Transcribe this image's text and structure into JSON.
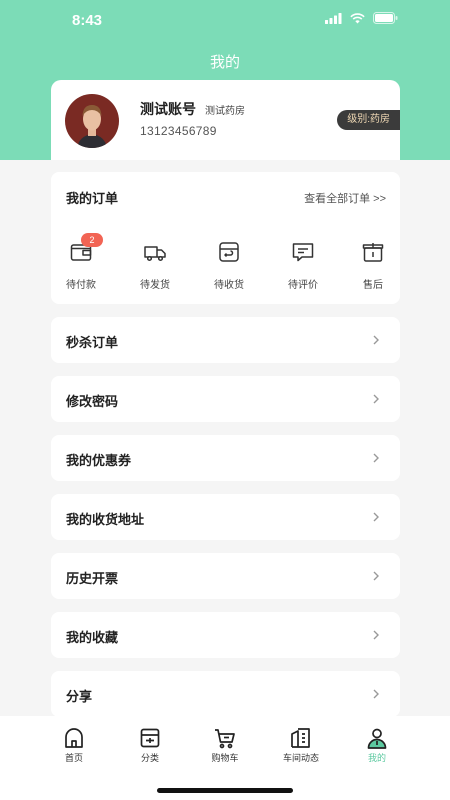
{
  "status_bar": {
    "time": "8:43"
  },
  "header": {
    "title": "我的"
  },
  "profile": {
    "name": "测试账号",
    "tag": "测试药房",
    "phone": "13123456789",
    "level": "级别:药房"
  },
  "orders": {
    "title": "我的订单",
    "view_all": "查看全部订单 >>",
    "items": [
      {
        "label": "待付款",
        "icon": "wallet-icon",
        "badge": "2"
      },
      {
        "label": "待发货",
        "icon": "truck-icon"
      },
      {
        "label": "待收货",
        "icon": "receive-box-icon"
      },
      {
        "label": "待评价",
        "icon": "comment-icon"
      },
      {
        "label": "售后",
        "icon": "after-sale-box-icon"
      }
    ]
  },
  "menu": [
    {
      "label": "秒杀订单"
    },
    {
      "label": "修改密码"
    },
    {
      "label": "我的优惠券"
    },
    {
      "label": "我的收货地址"
    },
    {
      "label": "历史开票"
    },
    {
      "label": "我的收藏"
    },
    {
      "label": "分享"
    }
  ],
  "tabbar": {
    "items": [
      {
        "label": "首页",
        "icon": "home-icon"
      },
      {
        "label": "分类",
        "icon": "category-icon"
      },
      {
        "label": "购物车",
        "icon": "cart-icon"
      },
      {
        "label": "车间动态",
        "icon": "news-icon"
      },
      {
        "label": "我的",
        "icon": "profile-icon",
        "active": true
      }
    ]
  },
  "colors": {
    "accent": "#7cdcb7",
    "active_tab": "#5cc9a0",
    "badge": "#f26454",
    "level_badge_bg": "#3b3b3b"
  }
}
